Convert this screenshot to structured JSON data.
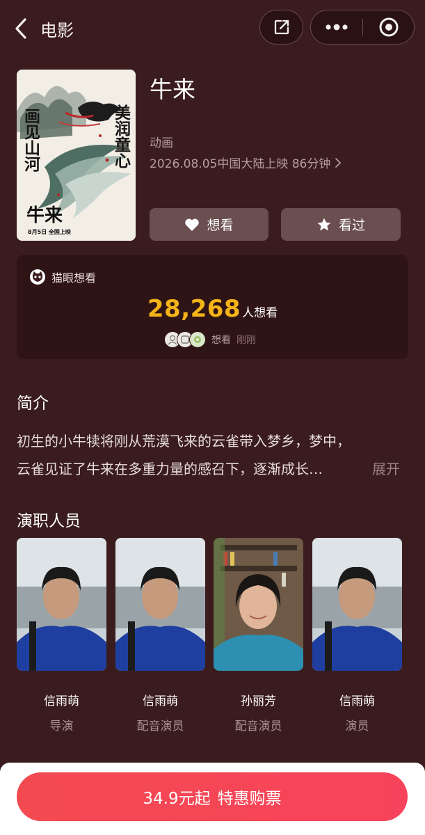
{
  "header": {
    "title": "电影",
    "back_icon": "chevron-left-icon",
    "share_icon": "share-icon",
    "more_icon": "more-dots-icon",
    "close_icon": "target-icon"
  },
  "movie": {
    "title": "牛来",
    "genre": "动画",
    "release": "2026.08.05中国大陆上映 86分钟",
    "poster": {
      "left_text": "画见山河",
      "right_text": "美润童心",
      "title": "牛来",
      "date": "8月5日  全国上映"
    }
  },
  "actions": {
    "want_label": "想看",
    "seen_label": "看过"
  },
  "maoyan": {
    "label": "猫眼想看",
    "count": "28,268",
    "unit": "人想看",
    "recent_action": "想看",
    "recent_time": "刚刚"
  },
  "synopsis": {
    "title": "简介",
    "line1": "初生的小牛犊将刚从荒漠飞来的云雀带入梦乡，梦中，",
    "line2": "云雀见证了牛来在多重力量的感召下，逐渐成长…",
    "expand_label": "展开"
  },
  "cast": {
    "title": "演职人员",
    "members": [
      {
        "name": "信雨萌",
        "role": "导演"
      },
      {
        "name": "信雨萌",
        "role": "配音演员"
      },
      {
        "name": "孙丽芳",
        "role": "配音演员"
      },
      {
        "name": "信雨萌",
        "role": "演员"
      }
    ]
  },
  "buy": {
    "price": "34.9元起",
    "label": "特惠购票"
  },
  "colors": {
    "background": "#3b1c1e",
    "accent_count": "#f5b417",
    "buy_button": "#f34a52"
  }
}
